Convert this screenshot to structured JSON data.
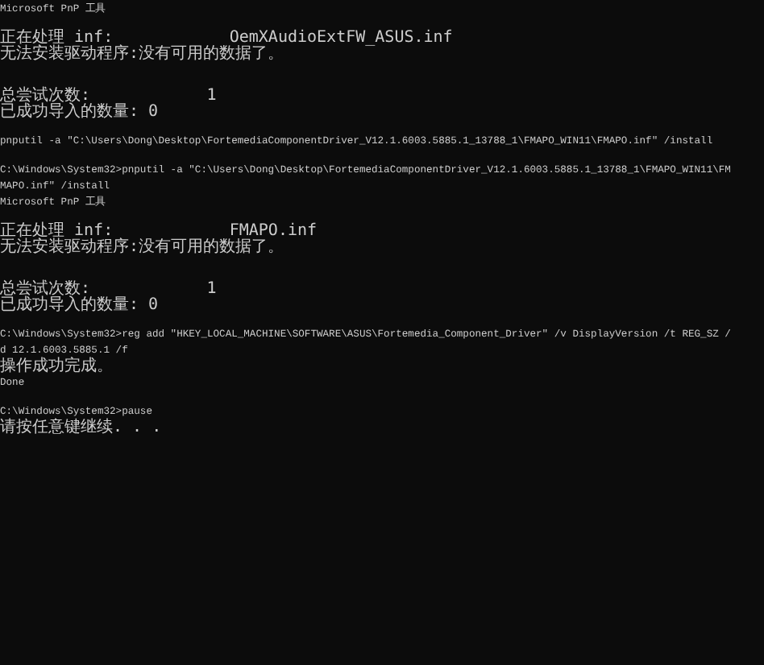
{
  "console": {
    "lines": [
      {
        "kind": "narrow",
        "text": "Microsoft PnP 工具"
      },
      {
        "kind": "blank"
      },
      {
        "kind": "wide",
        "text": "正在处理 inf:            OemXAudioExtFW_ASUS.inf"
      },
      {
        "kind": "wide",
        "text": "无法安装驱动程序:没有可用的数据了。"
      },
      {
        "kind": "blank"
      },
      {
        "kind": "blank"
      },
      {
        "kind": "wide",
        "text": "总尝试次数:            1"
      },
      {
        "kind": "wide",
        "text": "已成功导入的数量: 0"
      },
      {
        "kind": "blank"
      },
      {
        "kind": "narrow",
        "text": "pnputil -a \"C:\\Users\\Dong\\Desktop\\FortemediaComponentDriver_V12.1.6003.5885.1_13788_1\\FMAPO_WIN11\\FMAPO.inf\" /install"
      },
      {
        "kind": "blank"
      },
      {
        "kind": "narrow",
        "text": "C:\\Windows\\System32>pnputil -a \"C:\\Users\\Dong\\Desktop\\FortemediaComponentDriver_V12.1.6003.5885.1_13788_1\\FMAPO_WIN11\\FM"
      },
      {
        "kind": "narrow",
        "text": "MAPO.inf\" /install"
      },
      {
        "kind": "narrow",
        "text": "Microsoft PnP 工具"
      },
      {
        "kind": "blank"
      },
      {
        "kind": "wide",
        "text": "正在处理 inf:            FMAPO.inf"
      },
      {
        "kind": "wide",
        "text": "无法安装驱动程序:没有可用的数据了。"
      },
      {
        "kind": "blank"
      },
      {
        "kind": "blank"
      },
      {
        "kind": "wide",
        "text": "总尝试次数:            1"
      },
      {
        "kind": "wide",
        "text": "已成功导入的数量: 0"
      },
      {
        "kind": "blank"
      },
      {
        "kind": "narrow",
        "text": "C:\\Windows\\System32>reg add \"HKEY_LOCAL_MACHINE\\SOFTWARE\\ASUS\\Fortemedia_Component_Driver\" /v DisplayVersion /t REG_SZ /"
      },
      {
        "kind": "narrow",
        "text": "d 12.1.6003.5885.1 /f"
      },
      {
        "kind": "wide",
        "text": "操作成功完成。"
      },
      {
        "kind": "narrow",
        "text": "Done"
      },
      {
        "kind": "blank"
      },
      {
        "kind": "narrow",
        "text": "C:\\Windows\\System32>pause"
      },
      {
        "kind": "wide",
        "text": "请按任意键继续. . ."
      }
    ]
  }
}
